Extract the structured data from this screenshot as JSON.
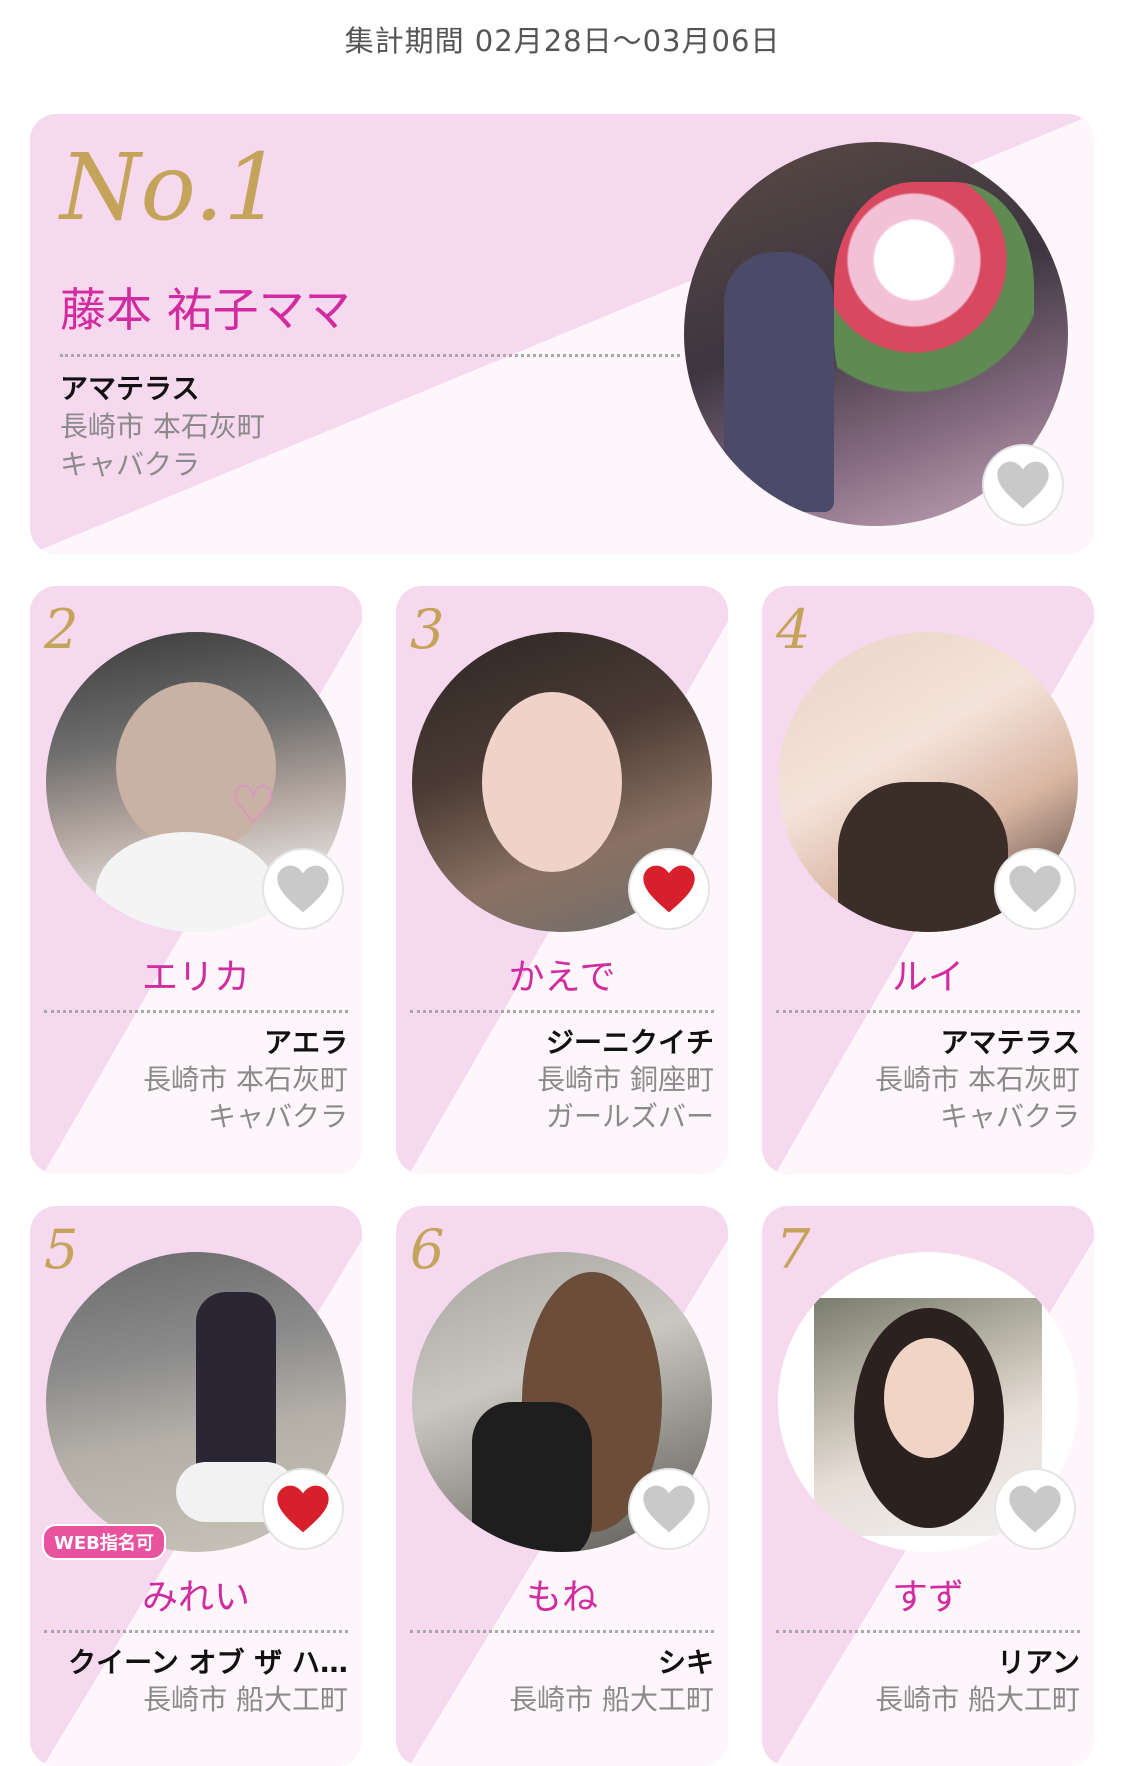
{
  "period": "集計期間 02月28日〜03月06日",
  "top": {
    "rank": "No.1",
    "name": "藤本 祐子ママ",
    "shop": "アマテラス",
    "address": "長崎市 本石灰町",
    "genre": "キャバクラ",
    "favorited": false
  },
  "cards": [
    {
      "rank": "2",
      "name": "エリカ",
      "shop": "アエラ",
      "address": "長崎市 本石灰町",
      "genre": "キャバクラ",
      "favorited": false
    },
    {
      "rank": "3",
      "name": "かえで",
      "shop": "ジーニクイチ",
      "address": "長崎市 銅座町",
      "genre": "ガールズバー",
      "favorited": true
    },
    {
      "rank": "4",
      "name": "ルイ",
      "shop": "アマテラス",
      "address": "長崎市 本石灰町",
      "genre": "キャバクラ",
      "favorited": false
    },
    {
      "rank": "5",
      "name": "みれい",
      "shop": "クイーン オブ ザ ハ…",
      "address": "長崎市 船大工町",
      "genre": "",
      "favorited": true,
      "badge": "WEB指名可"
    },
    {
      "rank": "6",
      "name": "もね",
      "shop": "シキ",
      "address": "長崎市 船大工町",
      "genre": "",
      "favorited": false
    },
    {
      "rank": "7",
      "name": "すず",
      "shop": "リアン",
      "address": "長崎市 船大工町",
      "genre": "",
      "favorited": false
    }
  ],
  "colors": {
    "accent": "#d22ba0",
    "card_pink": "#f6d9ef",
    "gold": "#c4a35a",
    "heart_on": "#d8202c",
    "heart_off": "#c9c9c9"
  }
}
